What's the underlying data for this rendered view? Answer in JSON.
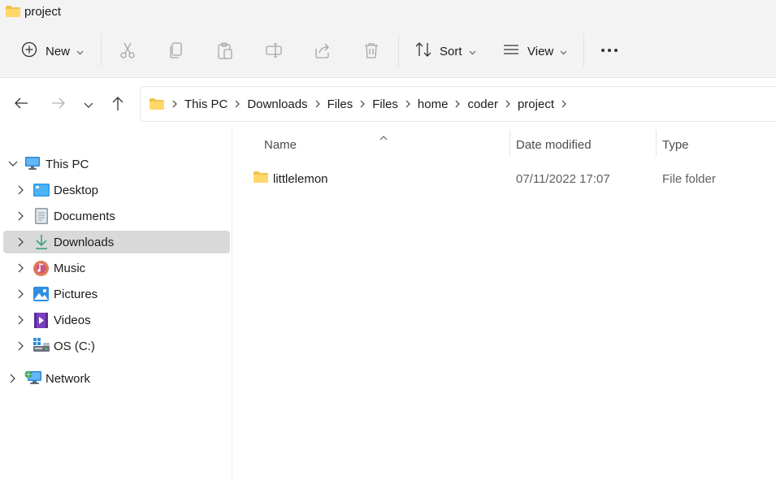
{
  "window": {
    "title": "project"
  },
  "toolbar": {
    "new_label": "New",
    "sort_label": "Sort",
    "view_label": "View",
    "icons": [
      "plus-circle-icon",
      "cut-icon",
      "copy-icon",
      "paste-icon",
      "rename-icon",
      "share-icon",
      "delete-icon",
      "sort-icon",
      "view-icon",
      "more-icon"
    ]
  },
  "address": {
    "crumbs": [
      "This PC",
      "Downloads",
      "Files",
      "Files",
      "home",
      "coder",
      "project"
    ]
  },
  "sidebar": {
    "items": [
      {
        "label": "This PC",
        "icon": "computer-icon",
        "expanded": true
      },
      {
        "label": "Desktop",
        "icon": "desktop-icon"
      },
      {
        "label": "Documents",
        "icon": "documents-icon"
      },
      {
        "label": "Downloads",
        "icon": "download-icon",
        "selected": true
      },
      {
        "label": "Music",
        "icon": "music-icon"
      },
      {
        "label": "Pictures",
        "icon": "pictures-icon"
      },
      {
        "label": "Videos",
        "icon": "videos-icon"
      },
      {
        "label": "OS (C:)",
        "icon": "drive-icon"
      },
      {
        "label": "Network",
        "icon": "network-icon"
      }
    ]
  },
  "list": {
    "columns": [
      "Name",
      "Date modified",
      "Type"
    ],
    "sorted_by": "Name",
    "rows": [
      {
        "name": "littlelemon",
        "date": "07/11/2022 17:07",
        "type": "File folder"
      }
    ]
  },
  "colors": {
    "folder": "#f0c24a",
    "selection": "#d9d9d9",
    "chrome": "#f3f3f3"
  }
}
